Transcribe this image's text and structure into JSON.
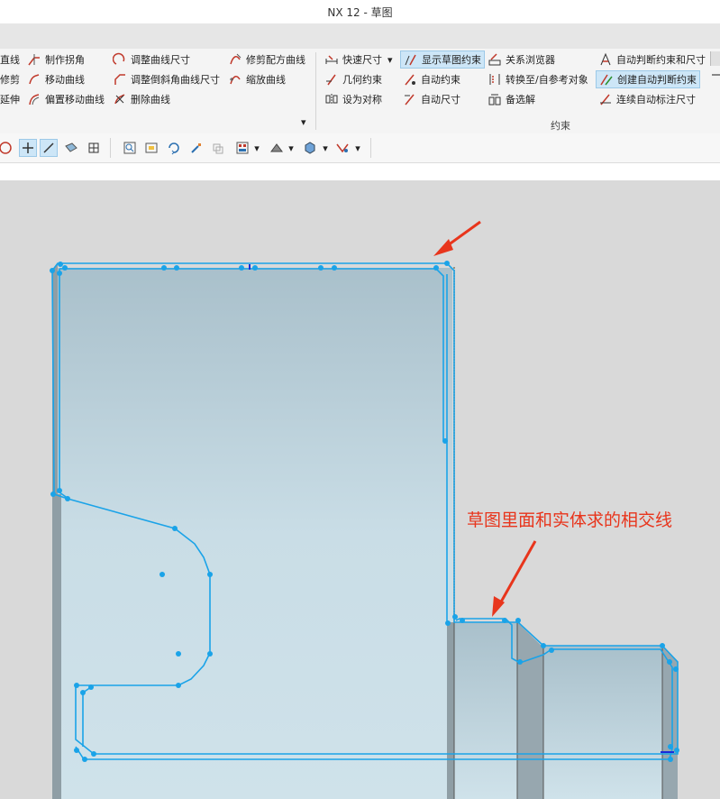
{
  "window": {
    "title": "NX 12 - 草图"
  },
  "ribbon": {
    "col1": [
      "直线",
      "修剪",
      "延伸"
    ],
    "col2": [
      "制作拐角",
      "移动曲线",
      "偏置移动曲线"
    ],
    "col3": [
      "调整曲线尺寸",
      "调整倒斜角曲线尺寸",
      "删除曲线"
    ],
    "col4": [
      "修剪配方曲线",
      "缩放曲线"
    ],
    "col5": [
      "快速尺寸",
      "几何约束",
      "设为对称"
    ],
    "col6": [
      "显示草图约束",
      "自动约束",
      "自动尺寸"
    ],
    "col7": [
      "关系浏览器",
      "转换至/自参考对象",
      "备选解"
    ],
    "col8": [
      "自动判断约束和尺寸",
      "创建自动判断约束",
      "连续自动标注尺寸"
    ],
    "group_label": "约束",
    "more_glyph": "▾",
    "dropdown_glyph": "▾"
  },
  "toolbar": {
    "icons": [
      "circle-icon",
      "crosshair-icon",
      "line-icon",
      "view-icon",
      "grid-icon",
      "zoom-icon",
      "fit-icon",
      "rotate-icon",
      "brush-icon",
      "layer-icon",
      "layout-icon",
      "render-icon",
      "solid-icon",
      "filter-icon"
    ]
  },
  "annotation": {
    "text": "草图里面和实体求的相交线"
  },
  "colors": {
    "sketch": "#1aa3e8",
    "arrow": "#e8351c",
    "highlight": "#cde6f7"
  }
}
